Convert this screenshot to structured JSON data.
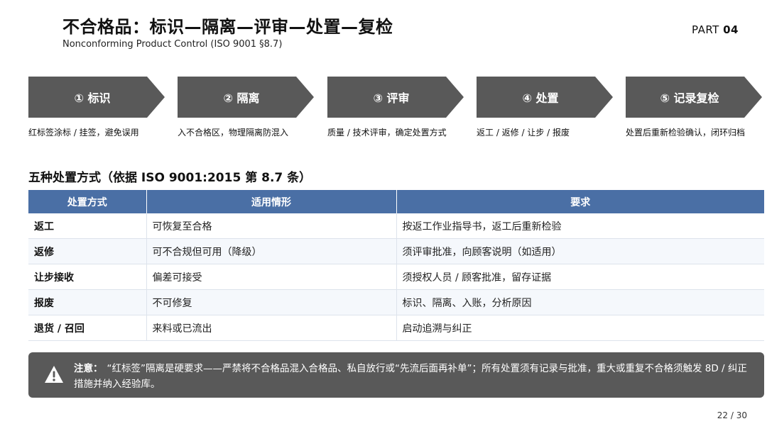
{
  "header": {
    "title": "不合格品：标识—隔离—评审—处置—复检",
    "subtitle": "Nonconforming Product Control (ISO 9001 §8.7)",
    "part_label": "PART",
    "part_number": "04"
  },
  "steps": [
    {
      "label": "① 标识",
      "desc": "红标签涂标 / 挂签，避免误用"
    },
    {
      "label": "② 隔离",
      "desc": "入不合格区，物理隔离防混入"
    },
    {
      "label": "③ 评审",
      "desc": "质量 / 技术评审，确定处置方式"
    },
    {
      "label": "④ 处置",
      "desc": "返工 / 返修 / 让步 / 报废"
    },
    {
      "label": "⑤ 记录复检",
      "desc": "处置后重新检验确认，闭环归档"
    }
  ],
  "section": {
    "heading": "五种处置方式（依据 ISO 9001:2015 第 8.7 条）"
  },
  "table": {
    "headers": [
      "处置方式",
      "适用情形",
      "要求"
    ],
    "rows": [
      [
        "返工",
        "可恢复至合格",
        "按返工作业指导书，返工后重新检验"
      ],
      [
        "返修",
        "可不合规但可用（降级）",
        "须评审批准，向顾客说明（如适用）"
      ],
      [
        "让步接收",
        "偏差可接受",
        "须授权人员 / 顾客批准，留存证据"
      ],
      [
        "报废",
        "不可修复",
        "标识、隔离、入账，分析原因"
      ],
      [
        "退货 / 召回",
        "来料或已流出",
        "启动追溯与纠正"
      ]
    ]
  },
  "notice": {
    "icon": "warning-icon",
    "label": "注意：",
    "text": "“红标签”隔离是硬要求——严禁将不合格品混入合格品、私自放行或“先流后面再补单”；所有处置须有记录与批准，重大或重复不合格须触发 8D / 纠正措施并纳入经验库。"
  },
  "footer": {
    "page": "22 / 30"
  },
  "colors": {
    "chevron": "#595959",
    "table_header": "#4a6fa5",
    "notice_bg": "#595959"
  }
}
